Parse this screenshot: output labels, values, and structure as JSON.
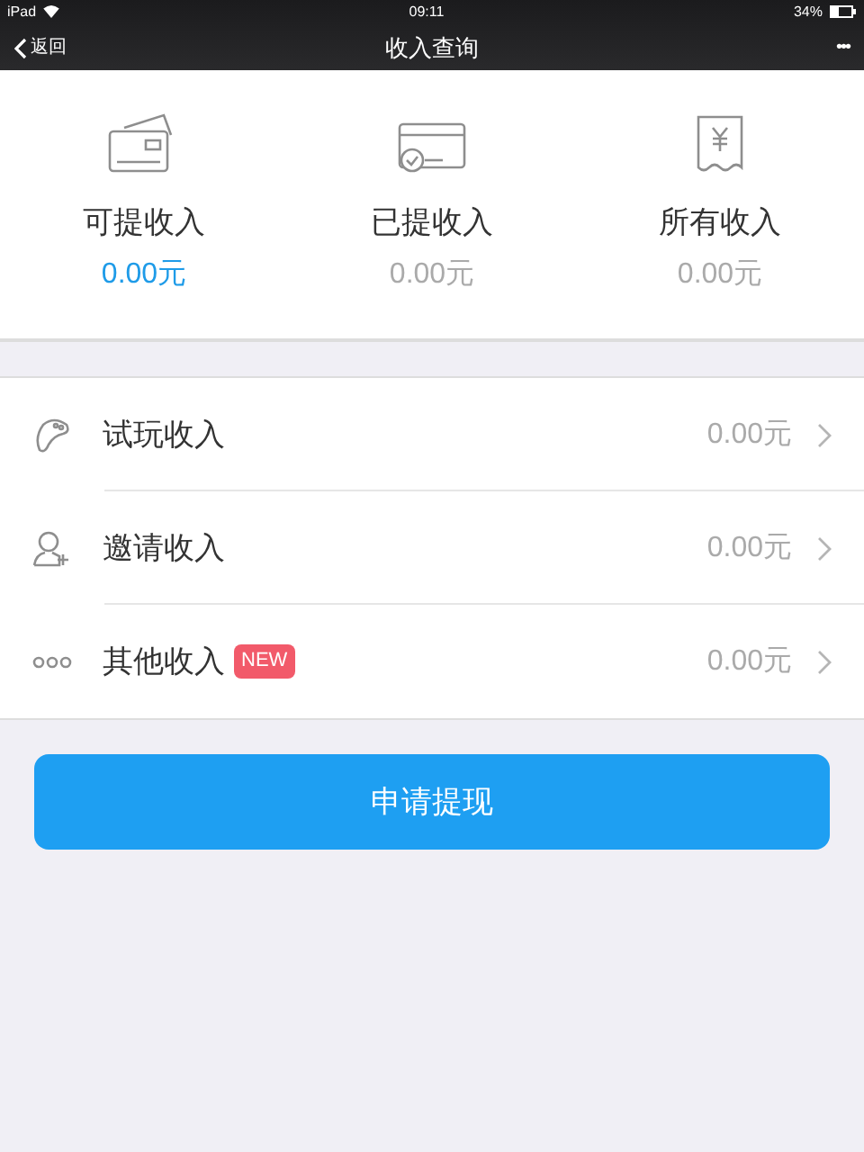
{
  "status_bar": {
    "device": "iPad",
    "time": "09:11",
    "battery": "34%"
  },
  "nav": {
    "back": "返回",
    "title": "收入查询",
    "more": "•••"
  },
  "summary": [
    {
      "kind": "cards",
      "label": "可提收入",
      "amount": "0.00元",
      "highlighted": true
    },
    {
      "kind": "card-check",
      "label": "已提收入",
      "amount": "0.00元",
      "highlighted": false
    },
    {
      "kind": "receipt",
      "label": "所有收入",
      "amount": "0.00元",
      "highlighted": false
    }
  ],
  "rows": [
    {
      "kind": "gamepad",
      "label": "试玩收入",
      "amount": "0.00元"
    },
    {
      "kind": "invite",
      "label": "邀请收入",
      "amount": "0.00元"
    },
    {
      "kind": "dots",
      "label": "其他收入",
      "badge": "NEW",
      "amount": "0.00元"
    }
  ],
  "button": "申请提现"
}
